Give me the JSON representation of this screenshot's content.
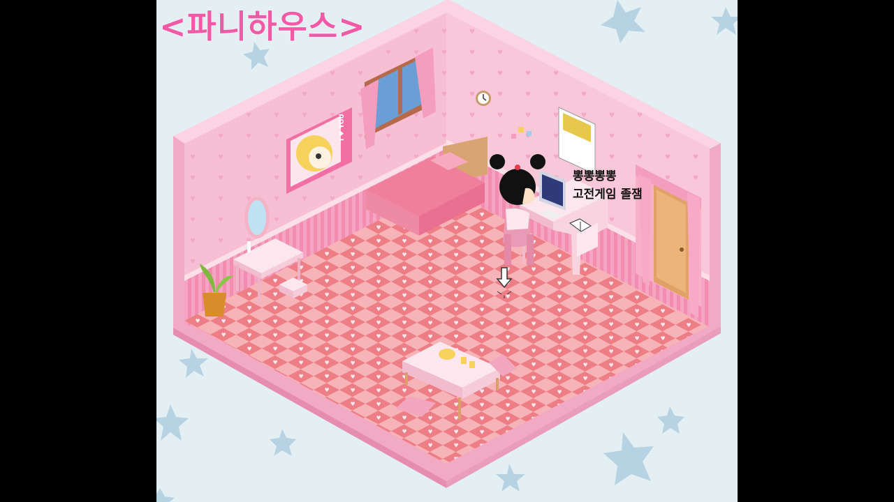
{
  "game": {
    "title": "<파니하우스>",
    "speech_bubble": {
      "line1": "뽕뽕뽕뽕",
      "line2": "고전게임 졸잼"
    }
  },
  "poster": {
    "text": "I ♥ YOU"
  },
  "colors": {
    "background": "#e3eff2",
    "star": "#b7d3e3",
    "wall_left": "#f7bfd4",
    "wall_right": "#f9c7da",
    "floor_light": "#f7b4b8",
    "floor_dark": "#ee7e86",
    "title": "#f05aa6"
  }
}
